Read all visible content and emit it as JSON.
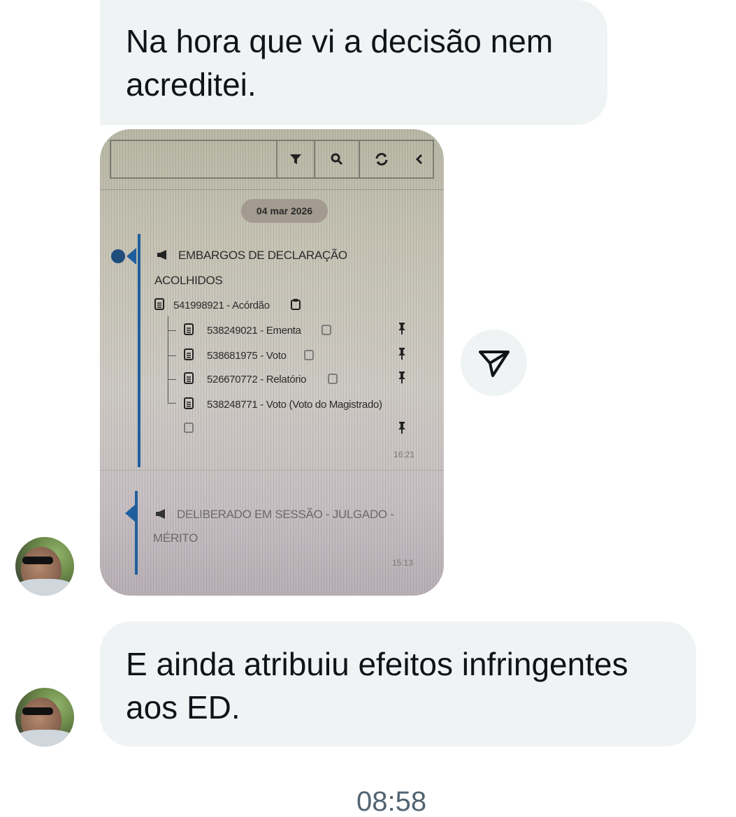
{
  "messages": {
    "first_bubble": "Na hora que vi a decisão nem acreditei.",
    "second_bubble": "E ainda atribuiu efeitos infringentes aos ED."
  },
  "photo": {
    "date_chip": "04 mar 2026",
    "entry1": {
      "title_line1": "EMBARGOS DE DECLARAÇÃO",
      "title_line2": "ACOLHIDOS",
      "doc_main": "541998921 - Acórdão",
      "children": [
        "538249021 - Ementa",
        "538681975 - Voto",
        "526670772 - Relatório",
        "538248771 - Voto (Voto do Magistrado)"
      ],
      "time": "16:21"
    },
    "entry2": {
      "title_line1": "DELIBERADO EM SESSÃO - JULGADO -",
      "title_line2": "MÉRITO",
      "time": "15:13"
    }
  },
  "footer": {
    "timestamp_partial": "08:58"
  },
  "icons": [
    "filter-icon",
    "search-icon",
    "refresh-icon",
    "chevron-left-icon",
    "megaphone-icon",
    "document-icon",
    "clipboard-icon",
    "pin-icon",
    "share-icon"
  ]
}
